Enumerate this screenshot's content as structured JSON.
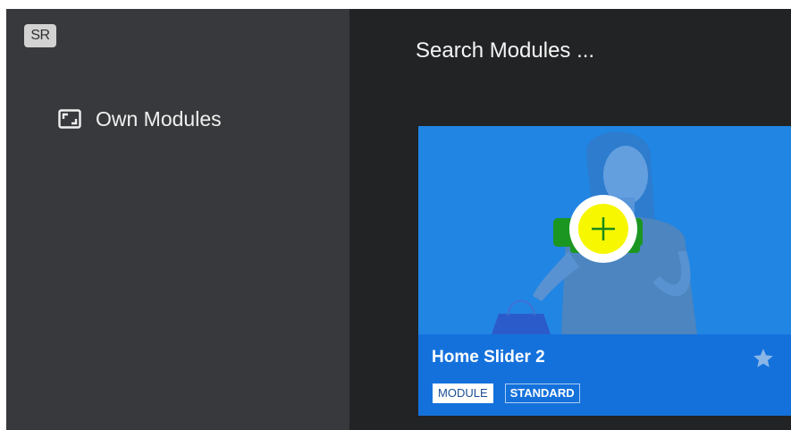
{
  "sidebar": {
    "logo_text": "SR",
    "items": [
      {
        "label": "Own Modules",
        "icon": "frame-corners-icon"
      }
    ]
  },
  "search": {
    "placeholder": "Search Modules ...",
    "value": ""
  },
  "card": {
    "title": "Home Slider 2",
    "tags": [
      "MODULE",
      "STANDARD"
    ],
    "add_icon": "plus-icon",
    "favorite_icon": "star-icon"
  },
  "colors": {
    "sidebar_bg": "#38393c",
    "main_bg": "#222325",
    "card_accent": "#1471dc",
    "add_button": "#f7f700",
    "add_plus": "#1a8a1a"
  }
}
